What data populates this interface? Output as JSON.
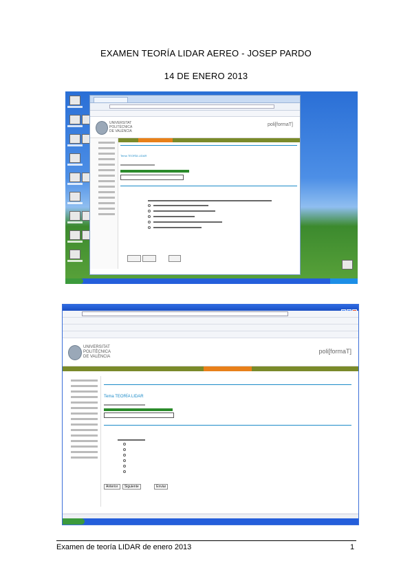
{
  "document": {
    "title_line1": "EXAMEN TEORÍA LIDAR AEREO -  JOSEP PARDO",
    "title_line2": "14 DE ENERO 2013",
    "footer_left": "Examen de teoría LIDAR de enero 2013",
    "footer_right": "1"
  },
  "screenshot1": {
    "university": [
      "UNIVERSITAT",
      "POLITÈCNICA",
      "DE VALÈNCIA"
    ],
    "brand": "poli[formaT]",
    "page_heading": "Tema TEORÍA LIDAR"
  },
  "screenshot2": {
    "university": [
      "UNIVERSITAT",
      "POLITÈCNICA",
      "DE VALÈNCIA"
    ],
    "brand": "poli[formaT]",
    "page_heading": "Tema TEORÍA LIDAR",
    "buttons": [
      "Anterior",
      "Siguiente",
      "Enviar"
    ]
  },
  "colors": {
    "upv_nav": "#7a8a2a",
    "upv_highlight": "#e8801a",
    "xp_blue": "#245edb",
    "link_blue": "#1a8ac8"
  }
}
